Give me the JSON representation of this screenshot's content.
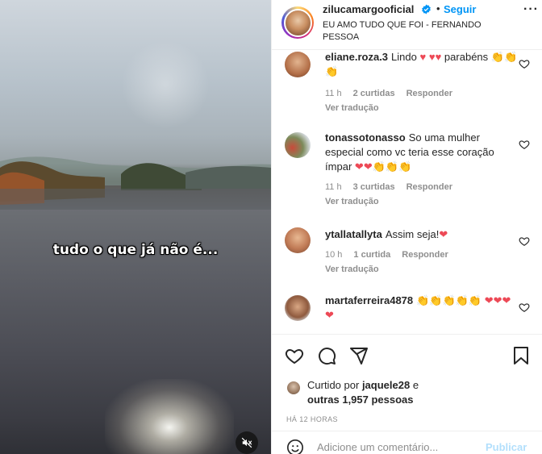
{
  "video": {
    "caption": "tudo o que já não é...",
    "mute_icon": "muted-speaker-icon"
  },
  "header": {
    "username": "zilucamargooficial",
    "dot": "•",
    "follow_label": "Seguir",
    "more_label": "···",
    "subtitle": "EU AMO TUDO QUE FOI - FERNANDO PESSOA"
  },
  "comments": [
    {
      "user": "eliane.roza.3",
      "text": "Lindo ♥ ♥♥ parabéns 👏👏👏",
      "time": "11 h",
      "likes": "2 curtidas",
      "reply": "Responder",
      "translate": "Ver tradução"
    },
    {
      "user": "tonassotonasso",
      "text": "So uma mulher especial como vc teria esse coração ímpar ❤❤👏👏👏",
      "time": "11 h",
      "likes": "3 curtidas",
      "reply": "Responder",
      "translate": "Ver tradução"
    },
    {
      "user": "ytallatallyta",
      "text": "Assim seja!❤",
      "time": "10 h",
      "likes": "1 curtida",
      "reply": "Responder",
      "translate": "Ver tradução"
    },
    {
      "user": "martaferreira4878",
      "text": "👏👏👏👏👏 ❤❤❤❤"
    }
  ],
  "likes": {
    "prefix": "Curtido por",
    "user": "jaquele28",
    "suffix": "e",
    "others": "outras 1,957 pessoas"
  },
  "timestamp": "HÁ 12 HORAS",
  "add_comment": {
    "placeholder": "Adicione um comentário...",
    "publish_label": "Publicar"
  },
  "colors": {
    "accent": "#0095f6",
    "heart": "#ed4956",
    "publish_disabled": "#b2dffc"
  }
}
